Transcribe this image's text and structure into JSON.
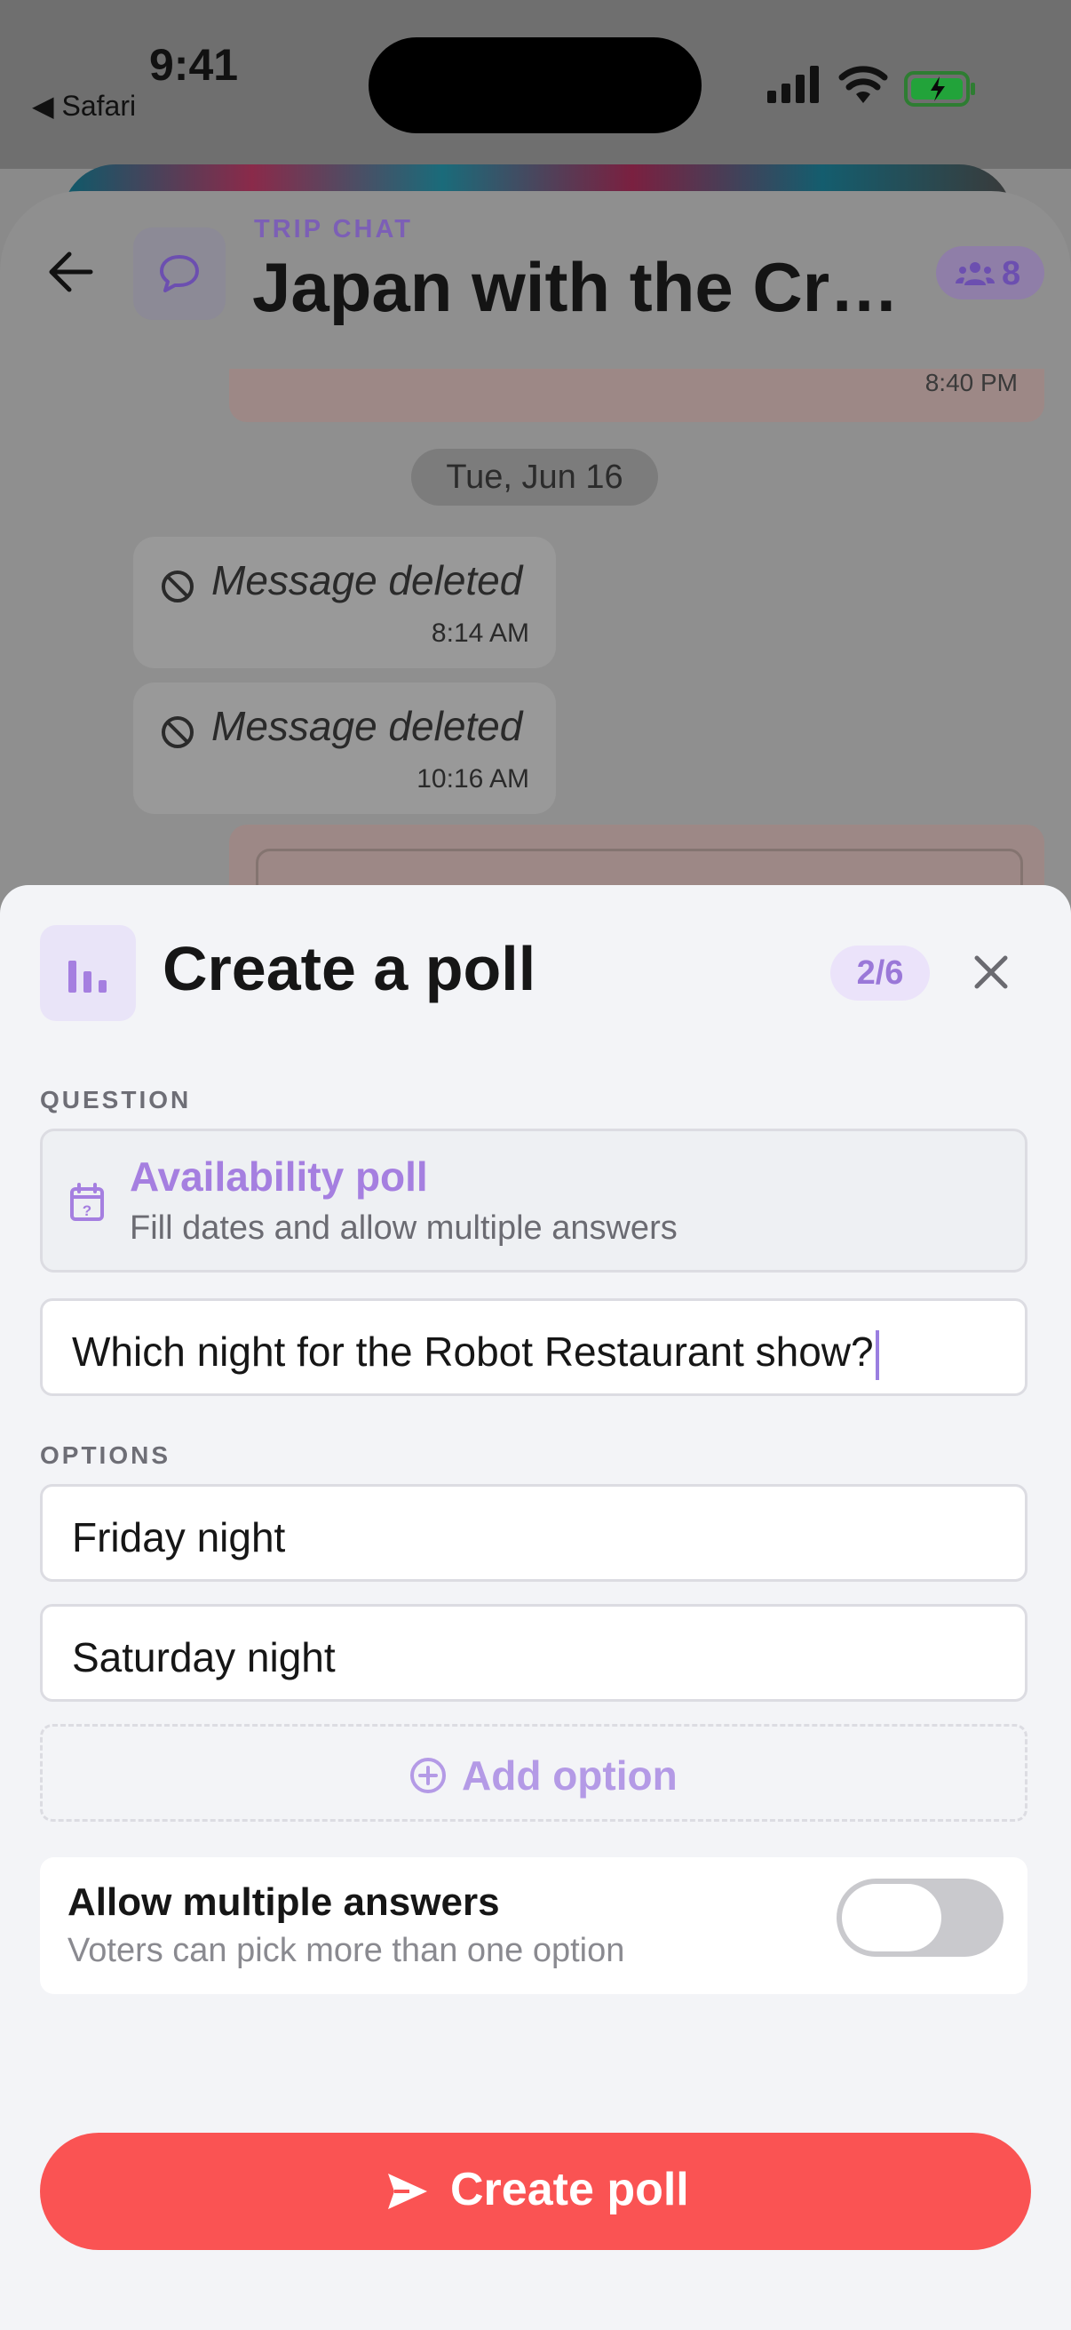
{
  "status_bar": {
    "time": "9:41",
    "back_app": "◀ Safari"
  },
  "chat_header": {
    "label": "TRIP CHAT",
    "title": "Japan with the Cr…",
    "member_count": "8"
  },
  "chat": {
    "prev_time": "8:40 PM",
    "date": "Tue, Jun 16",
    "messages": [
      {
        "text": "Message deleted",
        "time": "8:14 AM"
      },
      {
        "text": "Message deleted",
        "time": "10:16 AM"
      }
    ]
  },
  "poll": {
    "title": "Create a poll",
    "step": "2/6",
    "question_label": "QUESTION",
    "availability": {
      "title": "Availability poll",
      "subtitle": "Fill dates and allow multiple answers"
    },
    "question_value": "Which night for the Robot Restaurant show?",
    "options_label": "OPTIONS",
    "options": [
      "Friday night",
      "Saturday night"
    ],
    "add_option": "Add option",
    "multiple": {
      "title": "Allow multiple answers",
      "subtitle": "Voters can pick more than one option",
      "enabled": false
    },
    "submit": "Create poll"
  },
  "colors": {
    "accent": "#a57fe0",
    "primary_button": "#fa5353"
  }
}
